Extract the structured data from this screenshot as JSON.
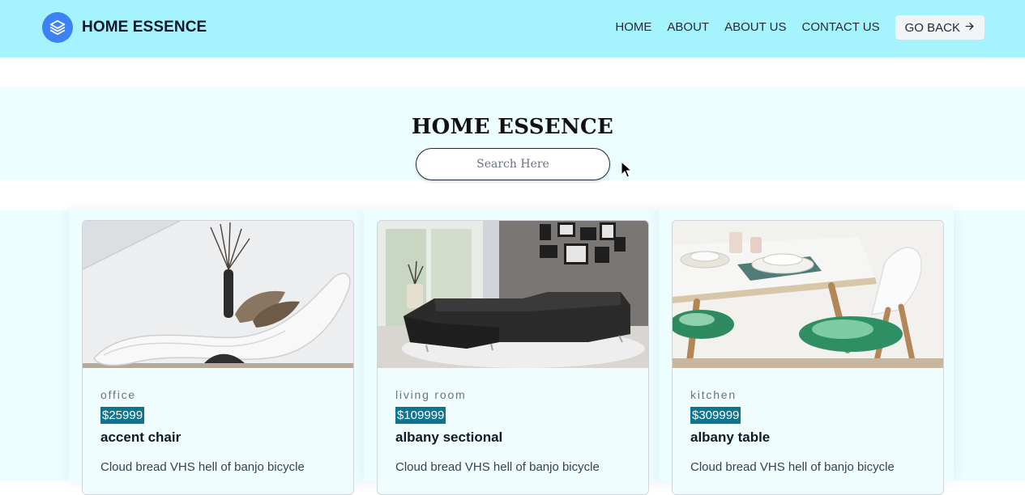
{
  "header": {
    "brand": "HOME ESSENCE",
    "logo_icon": "layers-icon",
    "nav": [
      "HOME",
      "ABOUT",
      "ABOUT US",
      "CONTACT US"
    ],
    "go_back_label": "GO BACK",
    "go_back_icon": "arrow-right-icon"
  },
  "hero": {
    "title": "HOME ESSENCE",
    "search_placeholder": "Search Here"
  },
  "products": [
    {
      "category": "office",
      "price": "$25999",
      "name": "accent chair",
      "description": "Cloud bread VHS hell of banjo bicycle"
    },
    {
      "category": "living room",
      "price": "$109999",
      "name": "albany sectional",
      "description": "Cloud bread VHS hell of banjo bicycle"
    },
    {
      "category": "kitchen",
      "price": "$309999",
      "name": "albany table",
      "description": "Cloud bread VHS hell of banjo bicycle"
    }
  ],
  "colors": {
    "header_bg": "#a5f3fc",
    "section_bg": "#ecfeff",
    "logo_bg": "#3b82f6",
    "price_highlight": "#0e7490"
  }
}
